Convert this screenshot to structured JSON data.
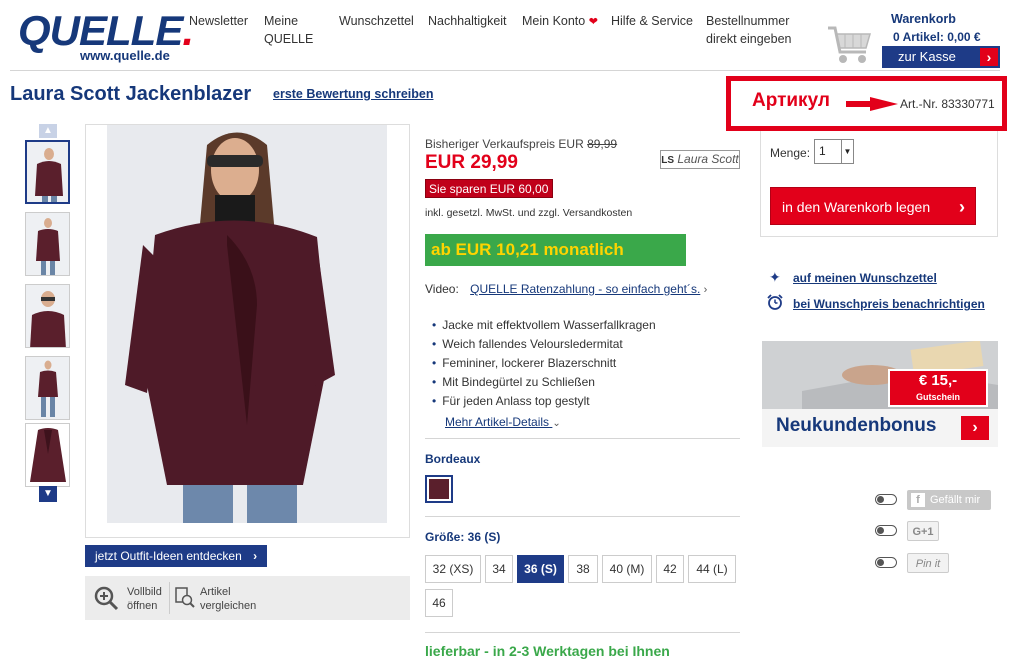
{
  "header": {
    "logo_main": "QUELLE",
    "logo_dot": ".",
    "logo_url": "www.quelle.de",
    "nav": [
      {
        "label": "Newsletter"
      },
      {
        "label": "Meine\nQUELLE"
      },
      {
        "label": "Wunschzettel"
      },
      {
        "label": "Nachhaltigkeit"
      },
      {
        "label": "Mein Konto"
      },
      {
        "label": "Hilfe & Service"
      },
      {
        "label": "Bestellnummer\ndirekt eingeben"
      }
    ],
    "cart_title": "Warenkorb",
    "cart_count": "0 Artikel: 0,00 €",
    "checkout_label": "zur Kasse"
  },
  "product": {
    "title": "Laura Scott Jackenblazer",
    "review_link": "erste Bewertung schreiben",
    "annotation_label": "Артикул",
    "article_number": "Art.-Nr. 83330771",
    "old_price_label": "Bisheriger Verkaufspreis EUR",
    "old_price_value": "89,99",
    "price": "EUR  29,99",
    "brand": "Laura Scott",
    "brand_initials": "LS",
    "savings": "Sie sparen EUR 60,00",
    "vat_note": "inkl. gesetzl. MwSt. und zzgl. Versandkosten",
    "monthly": "ab EUR 10,21  monatlich",
    "video_label": "Video:",
    "video_link": "QUELLE Ratenzahlung - so einfach geht´s.",
    "features": [
      "Jacke mit effektvollem Wasserfallkragen",
      "Weich fallendes Veloursledermitat",
      "Femininer, lockerer Blazerschnitt",
      "Mit Bindegürtel zu Schließen",
      "Für jeden Anlass top gestylt"
    ],
    "more_details": "Mehr Artikel-Details",
    "color_label": "Bordeaux",
    "color_hex": "#5a1f2c",
    "size_label": "Größe: 36 (S)",
    "sizes": [
      "32 (XS)",
      "34",
      "36 (S)",
      "38",
      "40 (M)",
      "42",
      "44 (L)",
      "46"
    ],
    "selected_size": "36 (S)",
    "delivery": "lieferbar - in 2-3 Werktagen bei Ihnen"
  },
  "gallery": {
    "outfit_button": "jetzt Outfit-Ideen entdecken",
    "zoom_label": "Vollbild\nöffnen",
    "compare_label": "Artikel\nvergleichen"
  },
  "buy": {
    "qty_label": "Menge:",
    "qty_value": "1",
    "add_to_cart": "in den Warenkorb legen",
    "wishlist": "auf meinen Wunschzettel",
    "price_alert": "bei Wunschpreis benachrichtigen"
  },
  "promo": {
    "title": "Neukundenbonus",
    "coupon_amount": "€ 15,-",
    "coupon_label": "Gutschein"
  },
  "social": {
    "facebook": "Gefällt mir",
    "facebook_glyph": "f",
    "gplus": "G+1",
    "pinterest": "Pin it"
  },
  "colors": {
    "brand_blue": "#16387a",
    "accent_red": "#e2001a",
    "green": "#3aa84a"
  }
}
